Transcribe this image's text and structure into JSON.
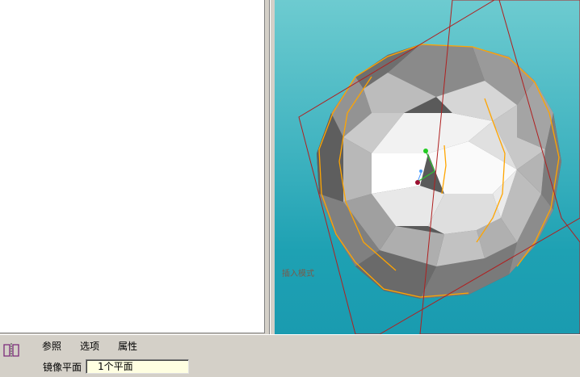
{
  "viewport": {
    "model_label": "插入模式"
  },
  "dashboard": {
    "tabs": [
      {
        "label": "参照"
      },
      {
        "label": "选项"
      },
      {
        "label": "属性"
      }
    ],
    "mirror_plane": {
      "label": "镜像平面",
      "value": "1个平面"
    }
  },
  "colors": {
    "viewport_top": "#6dcbd0",
    "viewport_bottom": "#1a9bb0",
    "model_edge_highlight": "#ffa500",
    "plane_outline": "#b02020"
  },
  "icons": {
    "mirror_tool": "mirror-icon",
    "csys": "coordinate-system-icon"
  }
}
